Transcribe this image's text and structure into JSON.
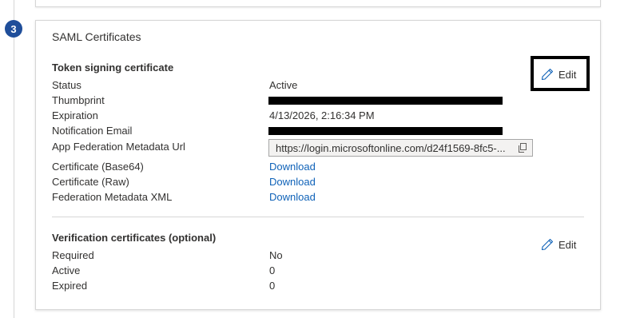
{
  "step": {
    "number": "3"
  },
  "card": {
    "title": "SAML Certificates",
    "token_signing": {
      "heading": "Token signing certificate",
      "edit_label": "Edit",
      "rows": {
        "status": {
          "label": "Status",
          "value": "Active"
        },
        "thumbprint": {
          "label": "Thumbprint"
        },
        "expiration": {
          "label": "Expiration",
          "value": "4/13/2026, 2:16:34 PM"
        },
        "notification_email": {
          "label": "Notification Email"
        },
        "metadata_url": {
          "label": "App Federation Metadata Url",
          "value": "https://login.microsoftonline.com/d24f1569-8fc5-..."
        },
        "cert_base64": {
          "label": "Certificate (Base64)",
          "link": "Download"
        },
        "cert_raw": {
          "label": "Certificate (Raw)",
          "link": "Download"
        },
        "federation_xml": {
          "label": "Federation Metadata XML",
          "link": "Download"
        }
      }
    },
    "verification": {
      "heading": "Verification certificates (optional)",
      "edit_label": "Edit",
      "rows": {
        "required": {
          "label": "Required",
          "value": "No"
        },
        "active": {
          "label": "Active",
          "value": "0"
        },
        "expired": {
          "label": "Expired",
          "value": "0"
        }
      }
    }
  },
  "colors": {
    "accent": "#0f62b8",
    "badge": "#1f4e9a"
  },
  "icons": {
    "edit": "pencil-icon",
    "copy": "copy-icon"
  }
}
